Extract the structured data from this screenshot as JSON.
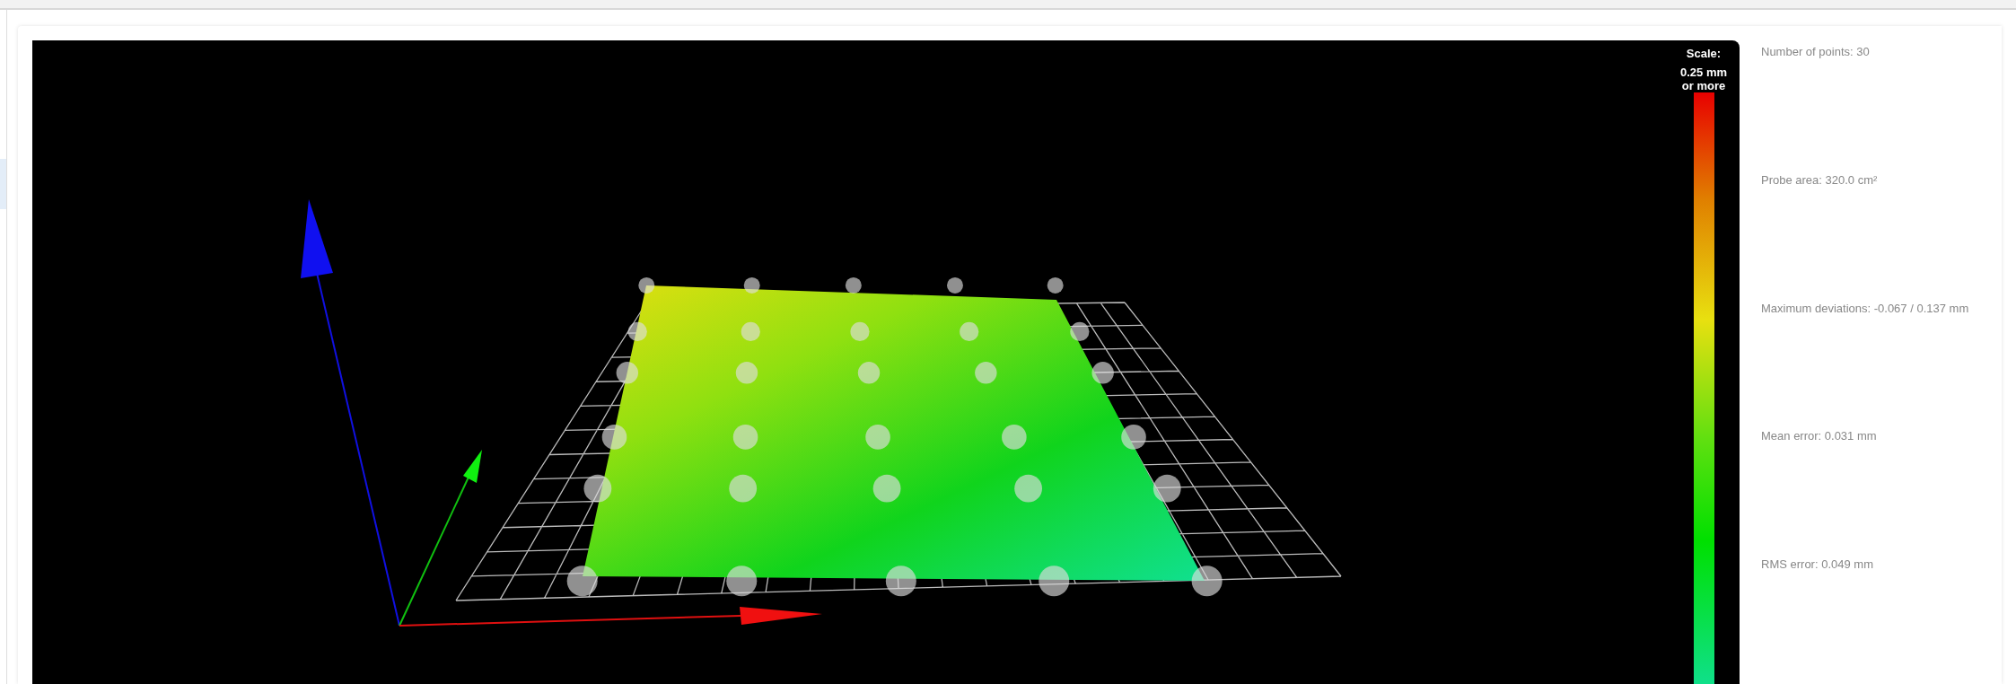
{
  "viewer": {
    "scale": {
      "title": "Scale:",
      "max_label": "0.25 mm or more"
    }
  },
  "stats": [
    {
      "text": "Number of points: 30"
    },
    {
      "text": "Probe area: 320.0 cm²"
    },
    {
      "text": "Maximum deviations: -0.067 / 0.137 mm"
    },
    {
      "text": "Mean error: 0.031 mm"
    },
    {
      "text": "RMS error: 0.049 mm"
    }
  ]
}
